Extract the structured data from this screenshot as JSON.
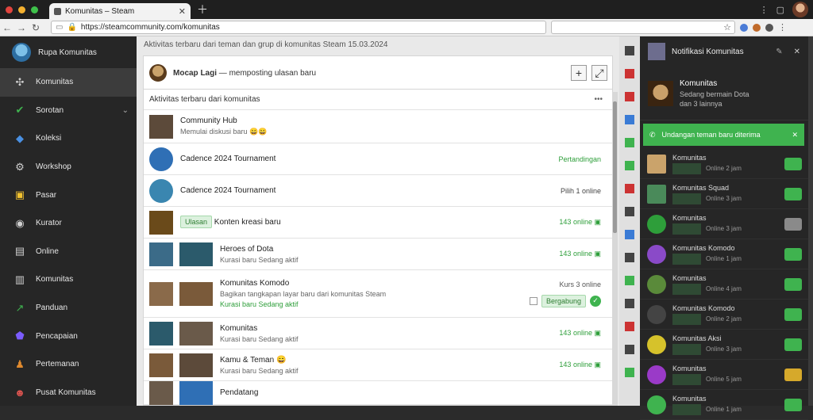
{
  "browser": {
    "tab_title": "Komunitas – Steam",
    "url": "https://steamcommunity.com/komunitas",
    "colors": {
      "close": "#e0443e",
      "minimize": "#f3b02f",
      "maximize": "#3ec04a"
    }
  },
  "sidebar": {
    "profile": "Rupa Komunitas",
    "items": [
      {
        "label": "Komunitas",
        "icon": "puzzle-icon",
        "color": "#cfcfcf"
      },
      {
        "label": "Sorotan",
        "icon": "shield-check-icon",
        "color": "#3fb34f"
      },
      {
        "label": "Koleksi",
        "icon": "game-icon",
        "color": "#4a90e2"
      },
      {
        "label": "Workshop",
        "icon": "gear-icon",
        "color": "#cfcfcf"
      },
      {
        "label": "Pasar",
        "icon": "market-icon",
        "color": "#f2c230"
      },
      {
        "label": "Kurator",
        "icon": "steam-icon",
        "color": "#cfcfcf"
      },
      {
        "label": "Online",
        "icon": "window-icon",
        "color": "#cfcfcf"
      },
      {
        "label": "Komunitas",
        "icon": "book-icon",
        "color": "#cfcfcf"
      },
      {
        "label": "Panduan",
        "icon": "chart-icon",
        "color": "#3fb34f"
      },
      {
        "label": "Pencapaian",
        "icon": "badge-icon",
        "color": "#7b5cff"
      },
      {
        "label": "Pertemanan",
        "icon": "friends-icon",
        "color": "#e08a2e"
      },
      {
        "label": "Pusat Komunitas",
        "icon": "person-icon",
        "color": "#d9534f"
      }
    ]
  },
  "main": {
    "notice": "Aktivitas terbaru dari teman dan grup di komunitas Steam 15.03.2024",
    "header": {
      "name": "Mocap Lagi",
      "sub": "— memposting ulasan baru"
    },
    "list_title": "Aktivitas terbaru dari komunitas",
    "list_more": "•••",
    "rows": [
      {
        "title": "Community Hub",
        "sub": "Memulai diskusi baru 😄😄",
        "status": ""
      },
      {
        "title": "Cadence 2024 Tournament",
        "sub": "",
        "status": "Pertandingan"
      },
      {
        "title": "Cadence 2024 Tournament",
        "sub": "",
        "status": "Pilih 1 online"
      },
      {
        "title": "Konten kreasi baru",
        "badge": "Ulasan",
        "status": "143 online"
      },
      {
        "title": "Heroes of Dota",
        "sub": "Kurasi baru Sedang aktif",
        "status": "143 online"
      },
      {
        "title": "Komunitas Komodo",
        "sub": "Bagikan tangkapan layar baru dari komunitas Steam",
        "sub2": "Kurasi baru Sedang aktif",
        "status": "Kurs 3 online",
        "badge": "Bergabung"
      },
      {
        "title": "Komunitas",
        "sub": "Kurasi baru Sedang aktif",
        "status": "143 online"
      },
      {
        "title": "Kamu & Teman 😄",
        "sub": "Kurasi baru Sedang aktif",
        "status": "143 online"
      },
      {
        "title": "Pendatang",
        "sub": "",
        "status": ""
      }
    ]
  },
  "right": {
    "title": "Notifikasi Komunitas",
    "user": {
      "name": "Komunitas",
      "l1": "Sedang bermain Dota",
      "l2": "dan 3 lainnya"
    },
    "banner": "Undangan teman baru diterima",
    "items": [
      {
        "t": "Komunitas",
        "s": "Online 2 jam",
        "color": "#3fb34f"
      },
      {
        "t": "Komunitas Squad",
        "s": "Online 3 jam",
        "color": "#3fb34f"
      },
      {
        "t": "Komunitas",
        "s": "Online 3 jam",
        "color": "#8a8a8a"
      },
      {
        "t": "Komunitas Komodo",
        "s": "Online 1 jam",
        "color": "#3fb34f"
      },
      {
        "t": "Komunitas",
        "s": "Online 4 jam",
        "color": "#3fb34f"
      },
      {
        "t": "Komunitas Komodo",
        "s": "Online 2 jam",
        "color": "#3fb34f"
      },
      {
        "t": "Komunitas Aksi",
        "s": "Online 3 jam",
        "color": "#3fb34f"
      },
      {
        "t": "Komunitas",
        "s": "Online 5 jam",
        "color": "#d6a92b"
      },
      {
        "t": "Komunitas",
        "s": "Online 1 jam",
        "color": "#3fb34f"
      }
    ]
  }
}
